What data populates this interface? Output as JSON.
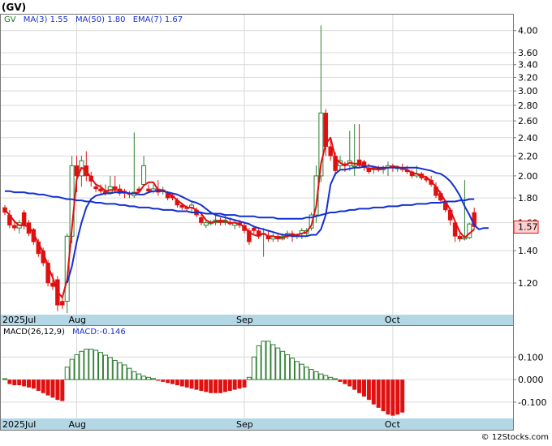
{
  "ticker": "(GV)",
  "watermark": "© 12Stocks.com",
  "colors": {
    "up_candle": "#2e7d32",
    "down_candle": "#e01010",
    "ma_fast": "#e01010",
    "ma_slow": "#1530d0",
    "legend_gv": "#1f7a1f",
    "legend_ma": "#1530d0",
    "axis_strip": "#b4d7e6",
    "macd_pos": "#2e7d32",
    "macd_neg": "#e01010",
    "price_box_bg": "#ffd0d0"
  },
  "chart_data": [
    {
      "type": "candlestick",
      "name": "price",
      "legend": [
        {
          "text": "GV",
          "role": "ticker"
        },
        {
          "text": "MA(3)  1.55",
          "role": "ma3"
        },
        {
          "text": "MA(50)  1.80",
          "role": "ma50"
        },
        {
          "text": "EMA(7)  1.67",
          "role": "ema7"
        }
      ],
      "y_scale": "log",
      "ylim": [
        1.04,
        4.3
      ],
      "y_ticks": [
        {
          "v": 4.0,
          "label": "4.00"
        },
        {
          "v": 3.6,
          "label": "3.60"
        },
        {
          "v": 3.4,
          "label": "3.40"
        },
        {
          "v": 3.2,
          "label": "3.20"
        },
        {
          "v": 3.0,
          "label": "3.00"
        },
        {
          "v": 2.8,
          "label": "2.80"
        },
        {
          "v": 2.6,
          "label": "2.60"
        },
        {
          "v": 2.4,
          "label": "2.40"
        },
        {
          "v": 2.2,
          "label": "2.20"
        },
        {
          "v": 2.0,
          "label": "2.00"
        },
        {
          "v": 1.8,
          "label": "1.80"
        },
        {
          "v": 1.6,
          "label": "1.60"
        },
        {
          "v": 1.4,
          "label": "1.40"
        },
        {
          "v": 1.2,
          "label": "1.20"
        }
      ],
      "x_ticks": [
        {
          "i": 0,
          "label": "2025Jul"
        },
        {
          "i": 15,
          "label": "Aug"
        },
        {
          "i": 50,
          "label": "Sep"
        },
        {
          "i": 81,
          "label": "Oct"
        }
      ],
      "last_price": "1.57",
      "candles": [
        [
          1.72,
          1.74,
          1.66,
          1.68
        ],
        [
          1.66,
          1.7,
          1.56,
          1.58
        ],
        [
          1.58,
          1.62,
          1.54,
          1.56
        ],
        [
          1.56,
          1.62,
          1.52,
          1.6
        ],
        [
          1.68,
          1.7,
          1.55,
          1.58
        ],
        [
          1.6,
          1.62,
          1.5,
          1.52
        ],
        [
          1.55,
          1.56,
          1.44,
          1.46
        ],
        [
          1.46,
          1.48,
          1.36,
          1.38
        ],
        [
          1.4,
          1.42,
          1.3,
          1.32
        ],
        [
          1.32,
          1.34,
          1.18,
          1.2
        ],
        [
          1.2,
          1.26,
          1.16,
          1.18
        ],
        [
          1.22,
          1.24,
          1.05,
          1.08
        ],
        [
          1.1,
          1.12,
          1.06,
          1.08
        ],
        [
          1.1,
          1.52,
          1.04,
          1.5
        ],
        [
          1.5,
          2.2,
          1.45,
          2.1
        ],
        [
          2.1,
          2.2,
          1.85,
          2.0
        ],
        [
          2.0,
          2.2,
          1.9,
          2.15
        ],
        [
          2.1,
          2.25,
          1.95,
          2.0
        ],
        [
          2.0,
          2.04,
          1.9,
          1.95
        ],
        [
          1.9,
          1.92,
          1.85,
          1.88
        ],
        [
          1.88,
          1.92,
          1.84,
          1.86
        ],
        [
          1.86,
          1.92,
          1.82,
          1.84
        ],
        [
          1.85,
          2.0,
          1.83,
          1.9
        ],
        [
          1.9,
          2.0,
          1.85,
          1.88
        ],
        [
          1.88,
          1.92,
          1.82,
          1.84
        ],
        [
          1.86,
          1.88,
          1.8,
          1.84
        ],
        [
          1.84,
          1.86,
          1.8,
          1.83
        ],
        [
          1.82,
          2.46,
          1.8,
          1.85
        ],
        [
          1.88,
          1.9,
          1.84,
          1.86
        ],
        [
          1.92,
          2.2,
          1.9,
          2.1
        ],
        [
          1.88,
          1.92,
          1.84,
          1.86
        ],
        [
          1.86,
          1.92,
          1.84,
          1.88
        ],
        [
          1.88,
          1.96,
          1.82,
          1.85
        ],
        [
          1.86,
          1.9,
          1.83,
          1.87
        ],
        [
          1.84,
          1.86,
          1.78,
          1.8
        ],
        [
          1.82,
          1.84,
          1.78,
          1.8
        ],
        [
          1.78,
          1.8,
          1.72,
          1.74
        ],
        [
          1.74,
          1.76,
          1.7,
          1.72
        ],
        [
          1.72,
          1.74,
          1.69,
          1.71
        ],
        [
          1.72,
          1.76,
          1.68,
          1.74
        ],
        [
          1.7,
          1.72,
          1.64,
          1.66
        ],
        [
          1.64,
          1.66,
          1.58,
          1.6
        ],
        [
          1.58,
          1.62,
          1.56,
          1.6
        ],
        [
          1.6,
          1.62,
          1.58,
          1.6
        ],
        [
          1.6,
          1.66,
          1.58,
          1.62
        ],
        [
          1.62,
          1.64,
          1.58,
          1.6
        ],
        [
          1.6,
          1.66,
          1.58,
          1.62
        ],
        [
          1.6,
          1.64,
          1.58,
          1.59
        ],
        [
          1.58,
          1.62,
          1.55,
          1.6
        ],
        [
          1.6,
          1.62,
          1.56,
          1.58
        ],
        [
          1.58,
          1.6,
          1.52,
          1.54
        ],
        [
          1.54,
          1.56,
          1.44,
          1.46
        ],
        [
          1.56,
          1.58,
          1.52,
          1.54
        ],
        [
          1.54,
          1.56,
          1.48,
          1.5
        ],
        [
          1.52,
          1.56,
          1.36,
          1.52
        ],
        [
          1.5,
          1.54,
          1.46,
          1.48
        ],
        [
          1.48,
          1.52,
          1.46,
          1.5
        ],
        [
          1.5,
          1.52,
          1.46,
          1.48
        ],
        [
          1.48,
          1.52,
          1.47,
          1.5
        ],
        [
          1.5,
          1.54,
          1.48,
          1.52
        ],
        [
          1.52,
          1.54,
          1.46,
          1.5
        ],
        [
          1.5,
          1.52,
          1.48,
          1.51
        ],
        [
          1.52,
          1.56,
          1.48,
          1.54
        ],
        [
          1.52,
          1.56,
          1.5,
          1.54
        ],
        [
          1.56,
          1.68,
          1.54,
          1.66
        ],
        [
          1.66,
          2.1,
          1.6,
          2.0
        ],
        [
          2.0,
          4.1,
          1.94,
          2.7
        ],
        [
          2.7,
          2.75,
          2.2,
          2.3
        ],
        [
          2.3,
          2.4,
          2.15,
          2.2
        ],
        [
          2.2,
          2.24,
          2.0,
          2.05
        ],
        [
          2.1,
          2.2,
          2.05,
          2.15
        ],
        [
          2.12,
          2.14,
          2.04,
          2.1
        ],
        [
          2.1,
          2.48,
          2.05,
          2.15
        ],
        [
          2.1,
          2.56,
          2.0,
          2.1
        ],
        [
          2.16,
          2.56,
          2.08,
          2.1
        ],
        [
          2.14,
          2.16,
          2.05,
          2.08
        ],
        [
          2.08,
          2.12,
          2.02,
          2.04
        ],
        [
          2.06,
          2.1,
          2.02,
          2.08
        ],
        [
          2.08,
          2.1,
          2.04,
          2.06
        ],
        [
          2.06,
          2.1,
          2.02,
          2.08
        ],
        [
          2.08,
          2.14,
          2.0,
          2.1
        ],
        [
          2.1,
          2.12,
          2.04,
          2.08
        ],
        [
          2.08,
          2.1,
          2.04,
          2.08
        ],
        [
          2.08,
          2.12,
          2.04,
          2.06
        ],
        [
          2.06,
          2.1,
          2.02,
          2.04
        ],
        [
          2.04,
          2.06,
          1.98,
          2.0
        ],
        [
          2.0,
          2.1,
          1.98,
          2.02
        ],
        [
          2.02,
          2.04,
          1.96,
          1.98
        ],
        [
          1.98,
          2.0,
          1.94,
          1.96
        ],
        [
          1.96,
          2.0,
          1.9,
          1.92
        ],
        [
          1.9,
          1.94,
          1.8,
          1.82
        ],
        [
          1.84,
          1.86,
          1.76,
          1.78
        ],
        [
          1.76,
          1.78,
          1.68,
          1.7
        ],
        [
          1.7,
          1.72,
          1.58,
          1.62
        ],
        [
          1.6,
          1.62,
          1.46,
          1.5
        ],
        [
          1.5,
          1.52,
          1.46,
          1.48
        ],
        [
          1.48,
          1.96,
          1.47,
          1.49
        ],
        [
          1.49,
          1.6,
          1.48,
          1.59
        ],
        [
          1.68,
          1.72,
          1.55,
          1.57
        ]
      ],
      "lines": [
        {
          "name": "MA(3)",
          "color_key": "ma_fast",
          "start": 0,
          "values": [
            1.7,
            1.66,
            1.61,
            1.58,
            1.58,
            1.57,
            1.52,
            1.45,
            1.39,
            1.3,
            1.23,
            1.15,
            1.12,
            1.22,
            1.56,
            1.97,
            2.08,
            2.05,
            1.98,
            1.92,
            1.9,
            1.86,
            1.87,
            1.87,
            1.87,
            1.85,
            1.84,
            1.84,
            1.85,
            1.91,
            1.94,
            1.94,
            1.87,
            1.87,
            1.84,
            1.82,
            1.78,
            1.75,
            1.72,
            1.72,
            1.7,
            1.67,
            1.62,
            1.6,
            1.61,
            1.61,
            1.61,
            1.6,
            1.6,
            1.59,
            1.57,
            1.53,
            1.51,
            1.5,
            1.52,
            1.5,
            1.5,
            1.49,
            1.49,
            1.5,
            1.51,
            1.51,
            1.52,
            1.53,
            1.58,
            1.73,
            2.12,
            2.33,
            2.4,
            2.18,
            2.13,
            2.1,
            2.13,
            2.12,
            2.12,
            2.09,
            2.07,
            2.07,
            2.06,
            2.07,
            2.08,
            2.09,
            2.09,
            2.07,
            2.06,
            2.03,
            2.02,
            2.0,
            1.99,
            1.95,
            1.9,
            1.84,
            1.77,
            1.7,
            1.61,
            1.53,
            1.49,
            1.52,
            1.55
          ]
        },
        {
          "name": "MA(50)",
          "color_key": "ma_slow",
          "start": 0,
          "values": [
            1.86,
            1.86,
            1.85,
            1.85,
            1.85,
            1.84,
            1.84,
            1.83,
            1.83,
            1.82,
            1.81,
            1.81,
            1.8,
            1.79,
            1.79,
            1.78,
            1.78,
            1.77,
            1.77,
            1.76,
            1.76,
            1.75,
            1.75,
            1.75,
            1.74,
            1.74,
            1.73,
            1.73,
            1.72,
            1.72,
            1.72,
            1.71,
            1.71,
            1.7,
            1.7,
            1.7,
            1.69,
            1.69,
            1.69,
            1.68,
            1.68,
            1.68,
            1.67,
            1.67,
            1.67,
            1.67,
            1.66,
            1.66,
            1.66,
            1.65,
            1.65,
            1.65,
            1.65,
            1.64,
            1.64,
            1.64,
            1.64,
            1.63,
            1.63,
            1.63,
            1.63,
            1.63,
            1.63,
            1.64,
            1.64,
            1.65,
            1.66,
            1.67,
            1.68,
            1.68,
            1.69,
            1.69,
            1.7,
            1.7,
            1.71,
            1.71,
            1.71,
            1.72,
            1.72,
            1.72,
            1.73,
            1.73,
            1.73,
            1.74,
            1.74,
            1.74,
            1.75,
            1.75,
            1.75,
            1.76,
            1.76,
            1.76,
            1.77,
            1.77,
            1.77,
            1.78,
            1.78,
            1.79,
            1.79
          ]
        },
        {
          "name": "EMA(7)",
          "color_key": "ma_slow",
          "start": 13,
          "values": [
            1.2,
            1.3,
            1.46,
            1.6,
            1.72,
            1.79,
            1.82,
            1.83,
            1.84,
            1.84,
            1.85,
            1.85,
            1.85,
            1.84,
            1.84,
            1.83,
            1.83,
            1.85,
            1.86,
            1.86,
            1.86,
            1.85,
            1.84,
            1.83,
            1.81,
            1.79,
            1.77,
            1.76,
            1.74,
            1.71,
            1.68,
            1.66,
            1.65,
            1.64,
            1.63,
            1.62,
            1.61,
            1.6,
            1.59,
            1.57,
            1.56,
            1.55,
            1.54,
            1.53,
            1.52,
            1.51,
            1.51,
            1.5,
            1.5,
            1.5,
            1.5,
            1.51,
            1.51,
            1.55,
            1.66,
            1.92,
            2.02,
            2.06,
            2.06,
            2.07,
            2.08,
            2.08,
            2.09,
            2.1,
            2.09,
            2.08,
            2.08,
            2.08,
            2.08,
            2.08,
            2.08,
            2.08,
            2.08,
            2.08,
            2.07,
            2.06,
            2.05,
            2.03,
            2.02,
            1.99,
            1.95,
            1.89,
            1.82,
            1.73,
            1.66,
            1.58,
            1.55,
            1.56,
            1.56
          ]
        }
      ]
    },
    {
      "type": "bar",
      "name": "macd",
      "legend": [
        {
          "text": "MACD(26,12,9)",
          "role": "title"
        },
        {
          "text": "MACD:-0.146",
          "role": "value"
        }
      ],
      "ylim": [
        -0.165,
        0.18
      ],
      "y_ticks": [
        {
          "v": 0.1,
          "label": "0.100"
        },
        {
          "v": 0.0,
          "label": "0.000"
        },
        {
          "v": -0.1,
          "label": "-0.100"
        }
      ],
      "x_ticks": [
        {
          "i": 0,
          "label": "2025Jul"
        },
        {
          "i": 15,
          "label": "Aug"
        },
        {
          "i": 50,
          "label": "Sep"
        },
        {
          "i": 81,
          "label": "Oct"
        }
      ],
      "values": [
        0.004,
        -0.02,
        -0.025,
        -0.025,
        -0.03,
        -0.035,
        -0.04,
        -0.05,
        -0.06,
        -0.07,
        -0.08,
        -0.09,
        -0.095,
        0.055,
        0.09,
        0.11,
        0.125,
        0.135,
        0.135,
        0.13,
        0.12,
        0.108,
        0.098,
        0.085,
        0.075,
        0.065,
        0.05,
        0.035,
        0.025,
        0.015,
        0.01,
        0.005,
        -0.005,
        -0.01,
        -0.015,
        -0.02,
        -0.025,
        -0.03,
        -0.035,
        -0.04,
        -0.045,
        -0.05,
        -0.055,
        -0.06,
        -0.06,
        -0.06,
        -0.055,
        -0.05,
        -0.045,
        -0.04,
        -0.035,
        0.01,
        0.1,
        0.15,
        0.17,
        0.17,
        0.155,
        0.14,
        0.125,
        0.11,
        0.095,
        0.08,
        0.068,
        0.055,
        0.045,
        0.035,
        0.025,
        0.018,
        0.01,
        0.004,
        -0.01,
        -0.02,
        -0.03,
        -0.045,
        -0.06,
        -0.075,
        -0.09,
        -0.11,
        -0.125,
        -0.14,
        -0.155,
        -0.16,
        -0.155,
        -0.146
      ]
    }
  ]
}
